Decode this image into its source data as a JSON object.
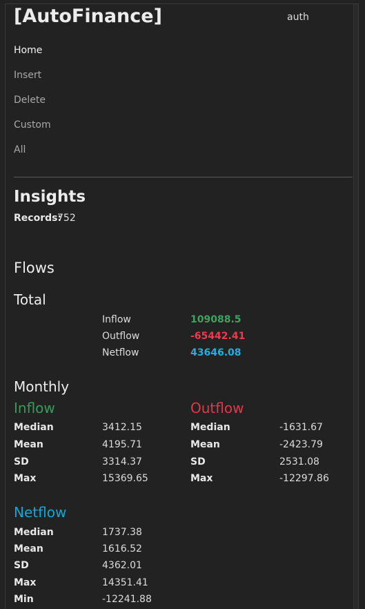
{
  "header": {
    "brand": "[AutoFinance]",
    "auth_label": "auth"
  },
  "nav": {
    "items": [
      {
        "label": "Home",
        "active": true
      },
      {
        "label": "Insert",
        "active": false
      },
      {
        "label": "Delete",
        "active": false
      },
      {
        "label": "Custom",
        "active": false
      },
      {
        "label": "All",
        "active": false
      }
    ]
  },
  "insights": {
    "title": "Insights",
    "records_label": "Records:",
    "records_value": "752"
  },
  "flows": {
    "title": "Flows",
    "total": {
      "title": "Total",
      "rows": [
        {
          "label": "Inflow",
          "value": "109088.5"
        },
        {
          "label": "Outflow",
          "value": "-65442.41"
        },
        {
          "label": "Netflow",
          "value": "43646.08"
        }
      ]
    },
    "monthly": {
      "title": "Monthly",
      "inflow": {
        "title": "Inflow",
        "stats": [
          {
            "label": "Median",
            "value": "3412.15"
          },
          {
            "label": "Mean",
            "value": "4195.71"
          },
          {
            "label": "SD",
            "value": "3314.37"
          },
          {
            "label": "Max",
            "value": "15369.65"
          }
        ]
      },
      "outflow": {
        "title": "Outflow",
        "stats": [
          {
            "label": "Median",
            "value": "-1631.67"
          },
          {
            "label": "Mean",
            "value": "-2423.79"
          },
          {
            "label": "SD",
            "value": "2531.08"
          },
          {
            "label": "Max",
            "value": "-12297.86"
          }
        ]
      },
      "netflow": {
        "title": "Netflow",
        "stats": [
          {
            "label": "Median",
            "value": "1737.38"
          },
          {
            "label": "Mean",
            "value": "1616.52"
          },
          {
            "label": "SD",
            "value": "4362.01"
          },
          {
            "label": "Max",
            "value": "14351.41"
          },
          {
            "label": "Min",
            "value": "-12241.88"
          }
        ]
      }
    }
  },
  "colors": {
    "background": "#222222",
    "inflow": "#3da45e",
    "outflow": "#e73d4e",
    "netflow": "#1fb0e0"
  }
}
